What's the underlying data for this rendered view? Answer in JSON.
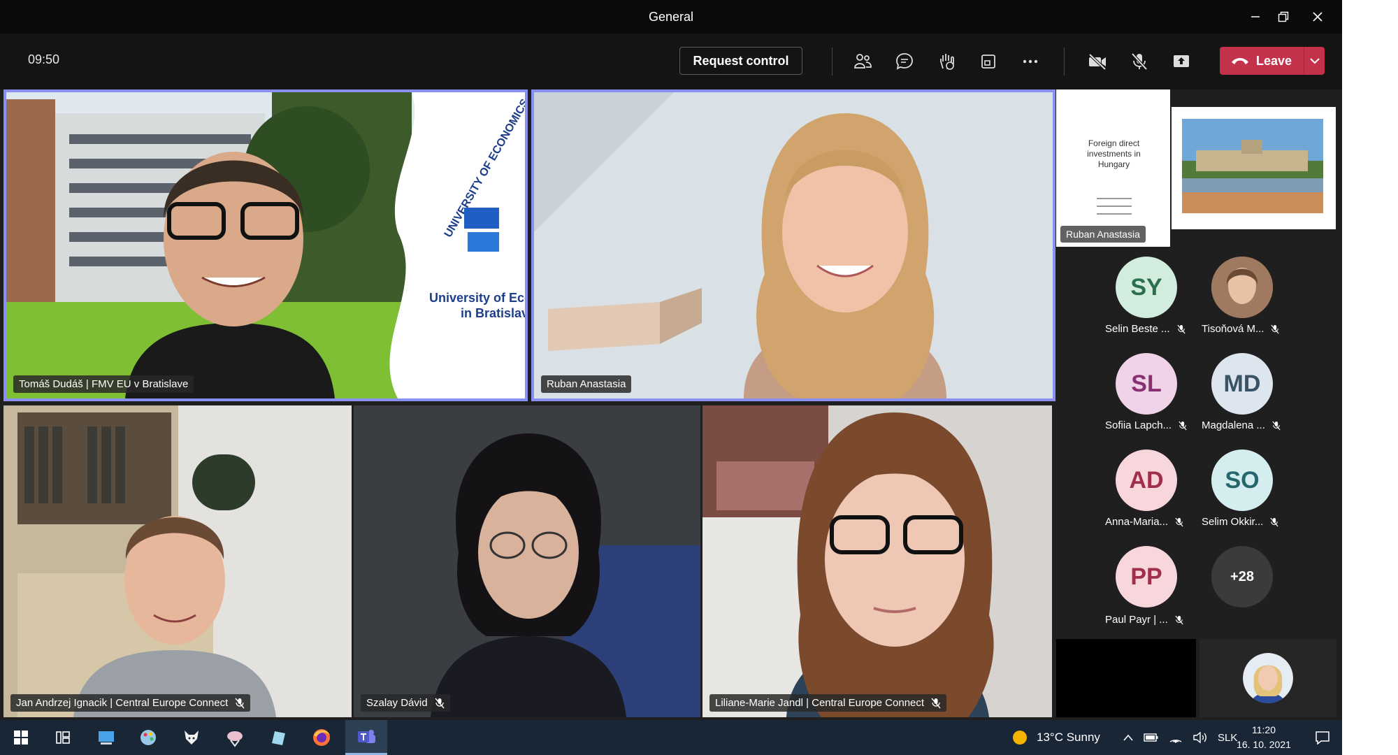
{
  "window": {
    "title": "General"
  },
  "toolbar": {
    "time": "09:50",
    "request_control": "Request control",
    "leave_label": "Leave"
  },
  "colors": {
    "leave": "#c4314b",
    "active_border": "#8a8ff2",
    "taskbar": "#182636"
  },
  "tiles": [
    {
      "name": "Tomáš Dudáš | FMV EU v Bratislave",
      "muted": false,
      "logo_text_1": "UNIVERSITY OF ECONOMICS",
      "logo_text_2": "University of Econ",
      "logo_text_3": "in Bratislava"
    },
    {
      "name": "Ruban Anastasia",
      "muted": false
    },
    {
      "name": "Jan Andrzej Ignacik | Central Europe Connect",
      "muted": true
    },
    {
      "name": "Szalay Dávid",
      "muted": true
    },
    {
      "name": "Liliane-Marie Jandl | Central Europe Connect",
      "muted": true
    }
  ],
  "shared": {
    "presenter": "Ruban Anastasia",
    "slide_title": "Foreign direct investments in Hungary"
  },
  "participants": [
    {
      "initials": "SY",
      "label": "Selin Beste ...",
      "bg": "#d2ecdd",
      "fg": "#2a6f4b"
    },
    {
      "initials": "",
      "label": "Tisoňová M...",
      "bg": "#a07a60",
      "fg": "#ffffff"
    },
    {
      "initials": "SL",
      "label": "Sofiia Lapch...",
      "bg": "#f1d3e9",
      "fg": "#8a3070"
    },
    {
      "initials": "MD",
      "label": "Magdalena ...",
      "bg": "#dde6ee",
      "fg": "#3a5366"
    },
    {
      "initials": "AD",
      "label": "Anna-Maria...",
      "bg": "#f7d6dc",
      "fg": "#a0304a"
    },
    {
      "initials": "SO",
      "label": "Selim Okkir...",
      "bg": "#d4eef0",
      "fg": "#26676d"
    },
    {
      "initials": "PP",
      "label": "Paul Payr | ...",
      "bg": "#f7d6dc",
      "fg": "#a0304a"
    },
    {
      "initials": "+28",
      "label": "",
      "bg": "#3b3b3b",
      "fg": "#ffffff"
    }
  ],
  "taskbar": {
    "weather": "13°C  Sunny",
    "language": "SLK",
    "clock_time": "11:20",
    "clock_date": "16. 10. 2021"
  }
}
